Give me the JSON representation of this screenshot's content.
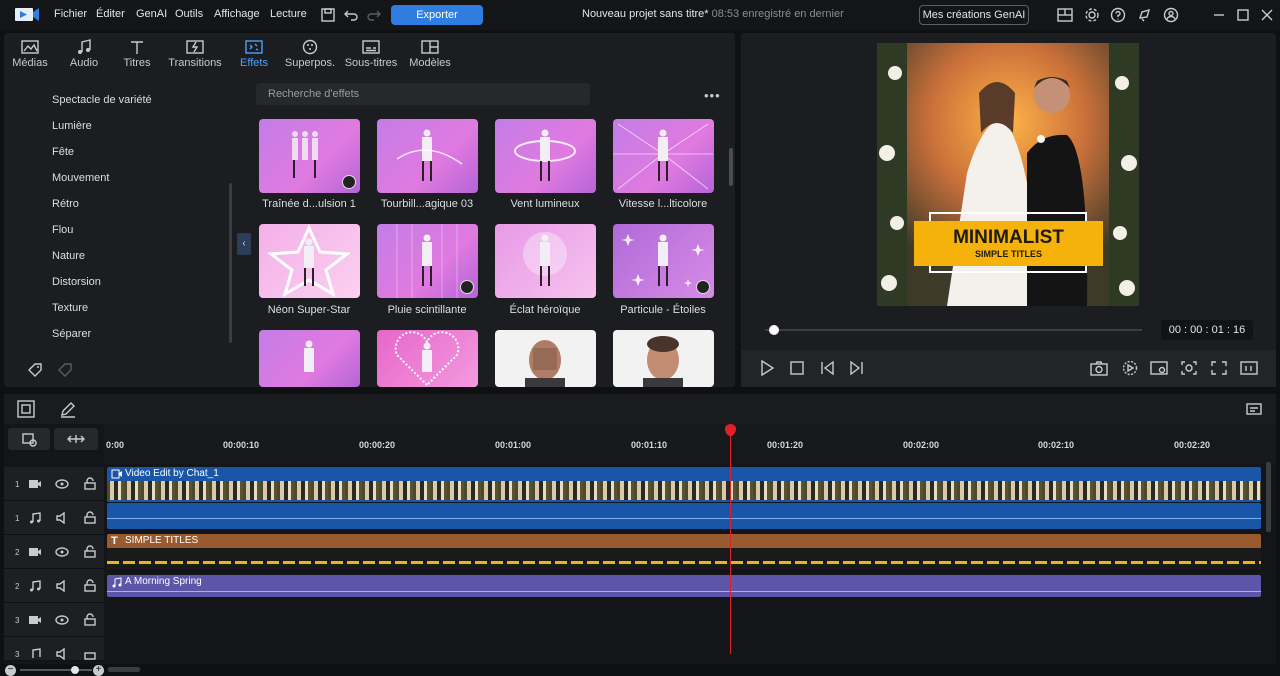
{
  "menu": {
    "items": [
      "Fichier",
      "Éditer",
      "GenAI",
      "Outils",
      "Affichage",
      "Lecture"
    ],
    "export_label": "Exporter",
    "project_title": "Nouveau projet sans titre*",
    "save_status": "08:53 enregistré en dernier",
    "genai_button": "Mes créations GenAI"
  },
  "tabs": [
    {
      "label": "Médias",
      "icon": "media-icon"
    },
    {
      "label": "Audio",
      "icon": "music-note-icon"
    },
    {
      "label": "Titres",
      "icon": "text-icon"
    },
    {
      "label": "Transitions",
      "icon": "transition-icon"
    },
    {
      "label": "Effets",
      "icon": "effects-icon",
      "active": true
    },
    {
      "label": "Superpos.",
      "icon": "overlay-icon"
    },
    {
      "label": "Sous-titres",
      "icon": "subtitles-icon"
    },
    {
      "label": "Modèles",
      "icon": "templates-icon"
    }
  ],
  "categories": [
    "Spectacle de variété",
    "Lumière",
    "Fête",
    "Mouvement",
    "Rétro",
    "Flou",
    "Nature",
    "Distorsion",
    "Texture",
    "Séparer"
  ],
  "search": {
    "placeholder": "Recherche d'effets"
  },
  "effects": [
    {
      "label": "Traînée d...ulsion 1",
      "download": true
    },
    {
      "label": "Tourbill...agique 03",
      "download": false
    },
    {
      "label": "Vent lumineux",
      "download": false
    },
    {
      "label": "Vitesse l...lticolore",
      "download": false
    },
    {
      "label": "Néon Super-Star",
      "download": false
    },
    {
      "label": "Pluie scintillante",
      "download": true
    },
    {
      "label": "Éclat héroïque",
      "download": false
    },
    {
      "label": "Particule - Étoiles",
      "download": true
    },
    {
      "label": "",
      "download": false
    },
    {
      "label": "",
      "download": false
    },
    {
      "label": "",
      "download": false
    },
    {
      "label": "",
      "download": false
    }
  ],
  "preview": {
    "title_main": "MINIMALIST",
    "title_sub": "SIMPLE TITLES",
    "timecode": "00 : 00 : 01 : 16",
    "playback_fraction": 0.02
  },
  "timeline": {
    "ruler": [
      "0:00",
      "00:00:10",
      "00:00:20",
      "00:01:00",
      "00:01:10",
      "00:01:20",
      "00:02:00",
      "00:02:10",
      "00:02:20"
    ],
    "tracks": [
      {
        "num": "1",
        "type": "video"
      },
      {
        "num": "1",
        "type": "audio"
      },
      {
        "num": "2",
        "type": "video"
      },
      {
        "num": "2",
        "type": "audio"
      },
      {
        "num": "3",
        "type": "video"
      },
      {
        "num": "3",
        "type": "audio"
      }
    ],
    "clips": {
      "video": "Video Edit by Chat_1",
      "title": "SIMPLE TITLES",
      "music": "A Morning Spring"
    }
  },
  "colors": {
    "accent": "#2f7de1",
    "active_tab": "#4ea0ff",
    "playhead": "#e0212b",
    "title_bg": "#f5b20a"
  }
}
